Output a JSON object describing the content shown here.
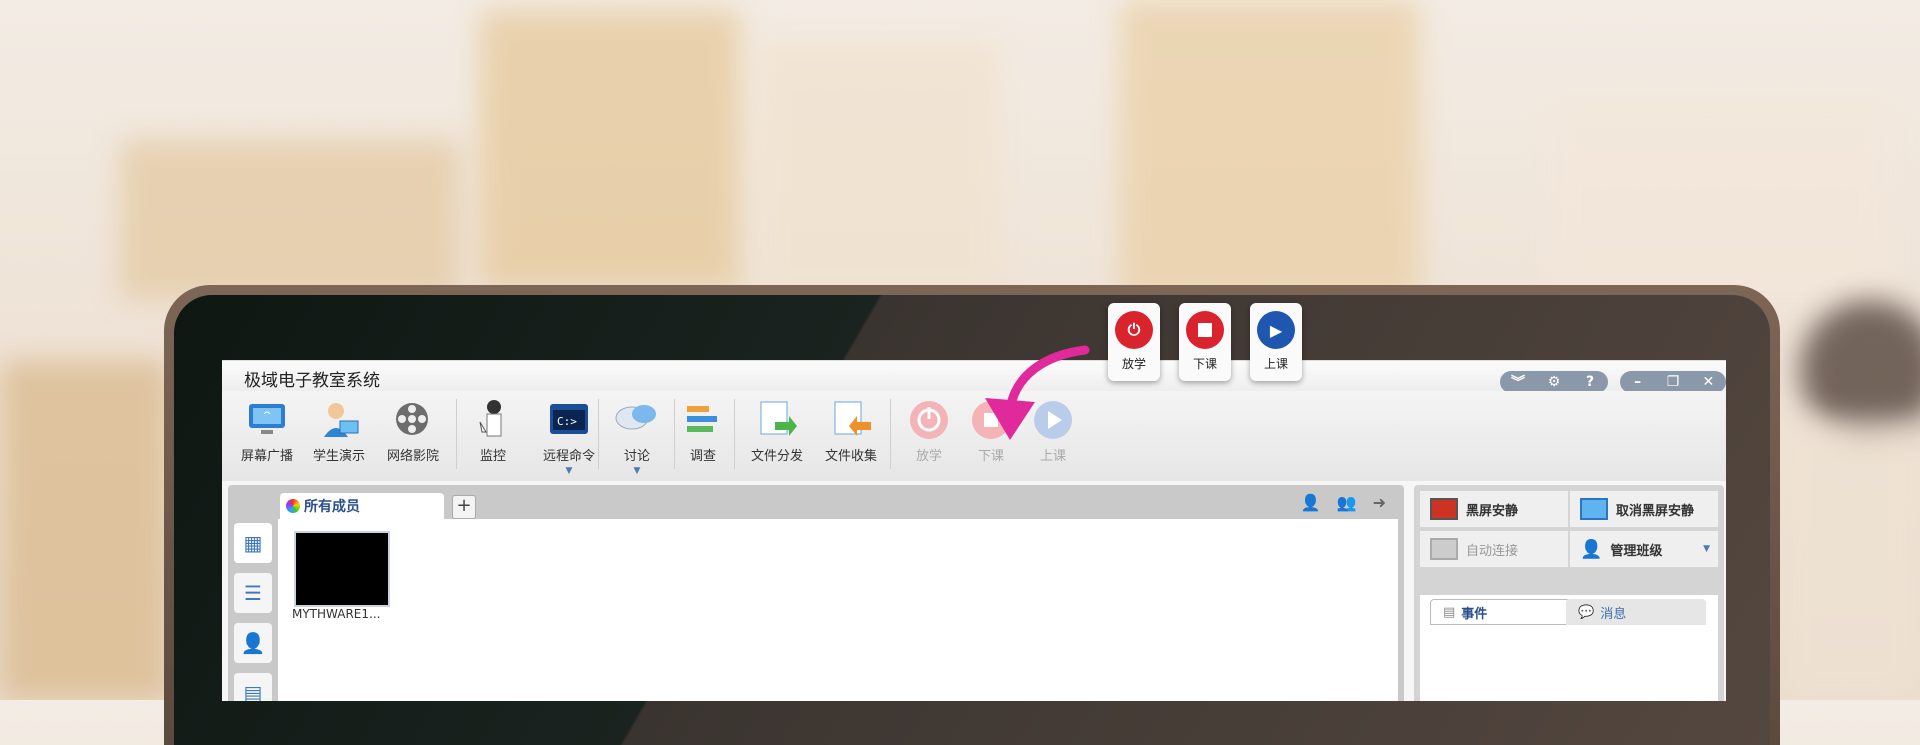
{
  "window": {
    "title": "极域电子教室系统"
  },
  "toolbar": {
    "broadcast": "屏幕广播",
    "student_demo": "学生演示",
    "net_video": "网络影院",
    "monitor": "监控",
    "remote_cmd": "远程命令",
    "discuss": "讨论",
    "survey": "调查",
    "file_dist": "文件分发",
    "file_collect": "文件收集",
    "dismiss": "放学",
    "end_class": "下课",
    "start_class": "上课"
  },
  "tabs": {
    "all_members": "所有成员",
    "add": "+"
  },
  "student": {
    "name": "MYTHWARE1..."
  },
  "right_panel": {
    "black_screen": "黑屏安静",
    "cancel_black": "取消黑屏安静",
    "auto_connect": "自动连接",
    "manage_class": "管理班级",
    "events_tab": "事件",
    "messages_tab": "消息"
  },
  "floating": {
    "dismiss": "放学",
    "end_class": "下课",
    "start_class": "上课"
  },
  "colors": {
    "accent_blue": "#2f63b4",
    "red": "#d9232d",
    "pink": "#e0299b"
  },
  "icons": [
    "screen-broadcast-icon",
    "student-demo-icon",
    "film-reel-icon",
    "monitor-person-icon",
    "terminal-icon",
    "chat-bubbles-icon",
    "survey-icon",
    "file-send-icon",
    "file-collect-icon",
    "power-icon",
    "stop-icon",
    "play-icon"
  ]
}
